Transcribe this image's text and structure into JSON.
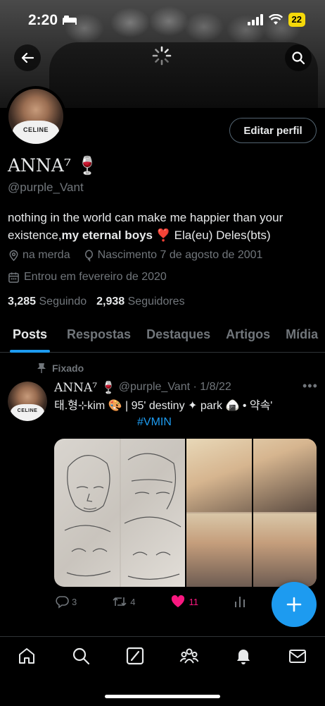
{
  "status_bar": {
    "time": "2:20",
    "battery": "22"
  },
  "profile": {
    "display_name": "ANNA⁷ 🍷",
    "handle": "@purple_Vant",
    "edit_button_label": "Editar perfil",
    "bio_part1": "nothing in the world can make me happier than your existence,",
    "bio_bold": "my eternal boys",
    "bio_part2": " ❣️ Ela(eu) Deles(bts)",
    "location": "na merda",
    "birthday": "Nascimento 7 de agosto de 2001",
    "joined": "Entrou em fevereiro de 2020",
    "following_count": "3,285",
    "following_label": "Seguindo",
    "followers_count": "2,938",
    "followers_label": "Seguidores",
    "avatar_shirt_text": "CELINE"
  },
  "tabs": [
    {
      "label": "Posts",
      "active": true
    },
    {
      "label": "Respostas",
      "active": false
    },
    {
      "label": "Destaques",
      "active": false
    },
    {
      "label": "Artigos",
      "active": false
    },
    {
      "label": "Mídia",
      "active": false
    }
  ],
  "pinned_post": {
    "pinned_label": "Fixado",
    "author_name": "ANNA⁷ 🍷",
    "author_handle": "@purple_Vant · 1/8/22",
    "text": "태.형⊹kim 🎨 | 95' destiny ✦ park 🍙 • 약속'",
    "hashtag": "#VMIN",
    "replies": "3",
    "reposts": "4",
    "likes": "11",
    "liked": true,
    "avatar_shirt_text": "CELINE"
  },
  "colors": {
    "accent": "#1d9bf0",
    "like": "#f91880",
    "muted": "#71767b",
    "background": "#000000"
  },
  "icons": {
    "back": "arrow-left-icon",
    "search": "search-icon",
    "loading": "spinner-icon",
    "location": "location-pin-icon",
    "birthday": "balloon-icon",
    "calendar": "calendar-icon",
    "pin": "pin-icon",
    "more": "more-icon",
    "reply": "reply-icon",
    "repost": "repost-icon",
    "like": "heart-icon",
    "views": "analytics-icon",
    "compose": "plus-icon",
    "nav": [
      "home-icon",
      "search-icon",
      "grok-icon",
      "communities-icon",
      "bell-icon",
      "mail-icon"
    ]
  }
}
